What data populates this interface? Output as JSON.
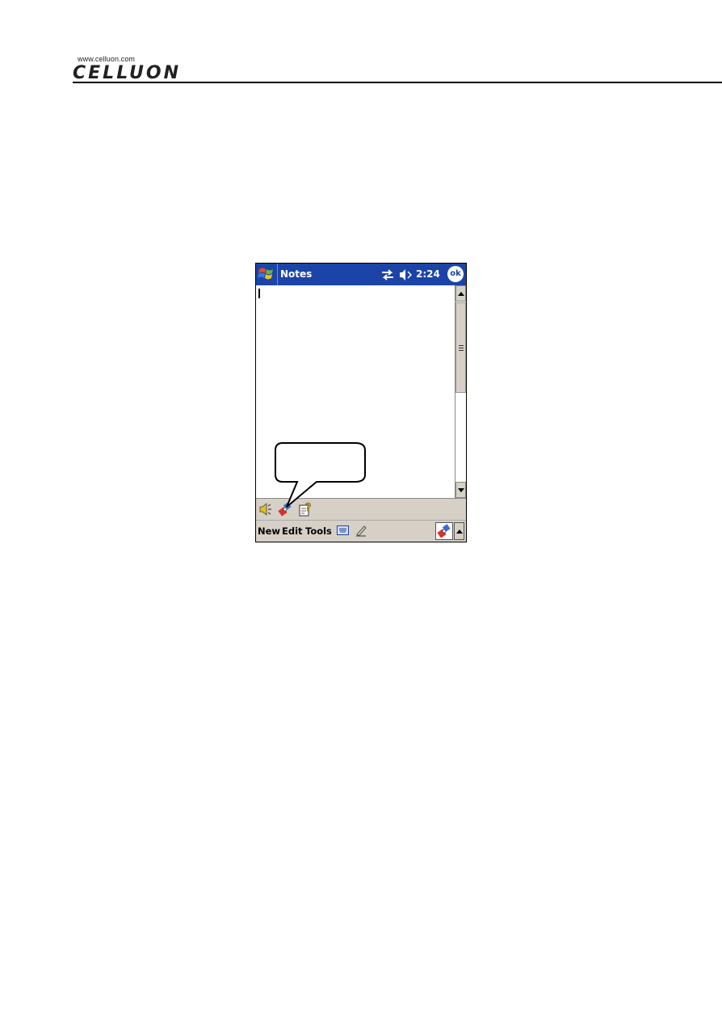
{
  "page_header": {
    "url": "www.celluon.com",
    "logo_text": "CELLUON"
  },
  "window": {
    "title": "Notes",
    "time": "2:24",
    "ok_label": "ok"
  },
  "menu": {
    "new_label": "New",
    "edit_label": "Edit",
    "tools_label": "Tools"
  },
  "icons": {
    "start": "windows-flag-icon",
    "sync": "sync-arrows-icon",
    "volume": "speaker-muted-icon",
    "toolbar": [
      "speaker-icon",
      "keyboard-tool-icon",
      "help-note-icon"
    ],
    "menubar": [
      "keyboard-icon",
      "pen-icon",
      "input-panel-icon"
    ]
  },
  "colors": {
    "titlebar": "#1c44a8",
    "chrome": "#d6d0c6"
  }
}
